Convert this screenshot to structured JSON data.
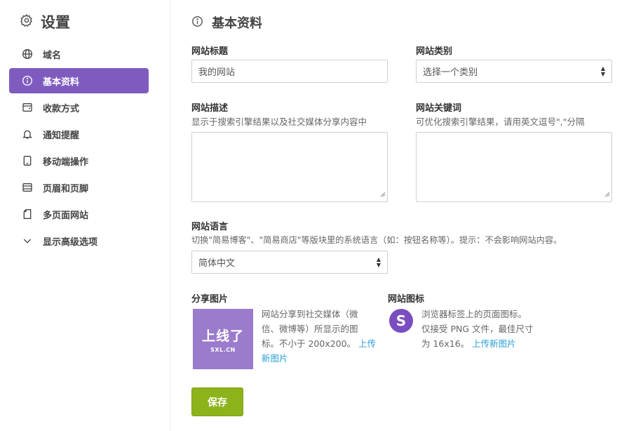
{
  "sidebar": {
    "title": "设置",
    "title_icon": "gear-icon",
    "items": [
      {
        "label": "域名",
        "icon": "globe-icon"
      },
      {
        "label": "基本资料",
        "icon": "info-icon",
        "active": true
      },
      {
        "label": "收款方式",
        "icon": "wallet-icon"
      },
      {
        "label": "通知提醒",
        "icon": "bell-icon"
      },
      {
        "label": "移动端操作",
        "icon": "mobile-icon"
      },
      {
        "label": "页眉和页脚",
        "icon": "header-footer-icon"
      },
      {
        "label": "多页面网站",
        "icon": "pages-icon"
      },
      {
        "label": "显示高级选项",
        "icon": "chevron-down-icon"
      }
    ]
  },
  "main": {
    "title": "基本资料",
    "title_icon": "info-icon",
    "site_title": {
      "label": "网站标题",
      "value": "我的网站"
    },
    "site_category": {
      "label": "网站类别",
      "value": "选择一个类别"
    },
    "site_description": {
      "label": "网站描述",
      "hint": "显示于搜索引擎结果以及社交媒体分享内容中"
    },
    "site_keywords": {
      "label": "网站关键词",
      "hint": "可优化搜索引擎结果，请用英文逗号\",\"分隔"
    },
    "site_language": {
      "label": "网站语言",
      "hint": "切换\"简易博客\"、\"简易商店\"等版块里的系统语言（如：按钮名称等）。提示：不会影响网站内容。",
      "value": "简体中文"
    },
    "share_image": {
      "label": "分享图片",
      "brand": "上线了",
      "brand_sub": "SXL.CN",
      "line1": "网站分享到社交媒体（微",
      "line2": "信、微博等）所显示的图",
      "line3": "标。不小于 200x200。",
      "upload_a": "上传",
      "upload_b": "新图片"
    },
    "site_icon": {
      "label": "网站图标",
      "letter": "S",
      "line1": "浏览器标签上的页面图标。",
      "line2": "仅接受 PNG 文件，最佳尺寸",
      "line3": "为 16x16。",
      "upload": "上传新图片"
    },
    "save_label": "保存"
  },
  "colors": {
    "accent": "#7f5bbf",
    "save": "#8cb31a",
    "link": "#2a9fd6"
  }
}
